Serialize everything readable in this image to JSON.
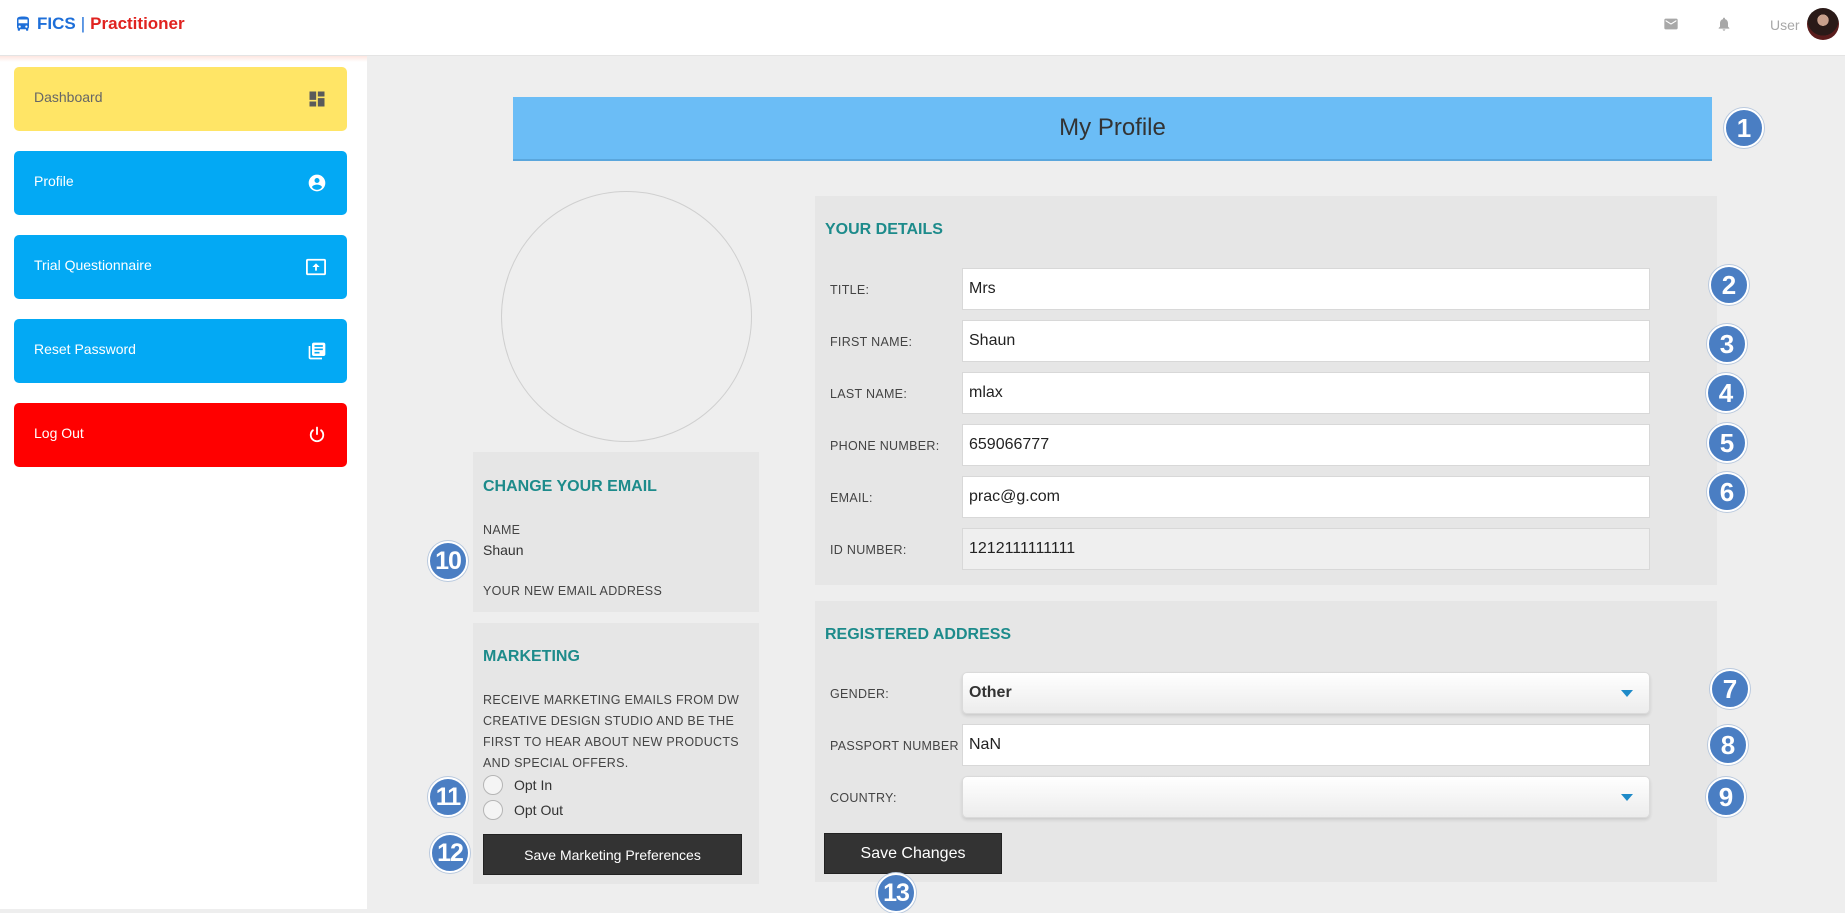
{
  "header": {
    "brand_primary": "FICS",
    "brand_separator": "|",
    "brand_secondary": "Practitioner",
    "user_label": "User",
    "icons": [
      "bus-icon",
      "mail-icon",
      "bell-icon"
    ]
  },
  "sidebar": {
    "items": [
      {
        "label": "Dashboard",
        "icon": "dashboard-icon"
      },
      {
        "label": "Profile",
        "icon": "account-circle-icon"
      },
      {
        "label": "Trial Questionnaire",
        "icon": "upload-screen-icon"
      },
      {
        "label": "Reset Password",
        "icon": "library-books-icon"
      },
      {
        "label": "Log Out",
        "icon": "power-icon"
      }
    ]
  },
  "page": {
    "title": "My Profile"
  },
  "details": {
    "heading": "YOUR DETAILS",
    "title_label": "TITLE:",
    "title_value": "Mrs",
    "first_name_label": "FIRST NAME:",
    "first_name_value": "Shaun",
    "last_name_label": "LAST NAME:",
    "last_name_value": "mlax",
    "phone_label": "PHONE NUMBER:",
    "phone_value": "659066777",
    "email_label": "EMAIL:",
    "email_value": "prac@g.com",
    "id_label": "ID NUMBER:",
    "id_value": "1212111111111"
  },
  "address": {
    "heading": "REGISTERED ADDRESS",
    "gender_label": "GENDER:",
    "gender_value": "Other",
    "passport_label": "PASSPORT NUMBER",
    "passport_value": "NaN",
    "country_label": "COUNTRY:",
    "country_value": ""
  },
  "change_email": {
    "heading": "CHANGE YOUR EMAIL",
    "name_label": "NAME",
    "name_value": "Shaun",
    "new_email_label": "YOUR NEW EMAIL ADDRESS"
  },
  "marketing": {
    "heading": "MARKETING",
    "description": "RECEIVE MARKETING EMAILS FROM DW CREATIVE DESIGN STUDIO AND BE THE FIRST TO HEAR ABOUT NEW PRODUCTS AND SPECIAL OFFERS.",
    "opt_in_label": "Opt In",
    "opt_out_label": "Opt Out",
    "save_label": "Save Marketing Preferences"
  },
  "actions": {
    "save_changes_label": "Save Changes"
  },
  "badges": [
    "1",
    "2",
    "3",
    "4",
    "5",
    "6",
    "7",
    "8",
    "9",
    "10",
    "11",
    "12",
    "13"
  ],
  "colors": {
    "accent_blue": "#03a9f4",
    "title_bar_blue": "#6bbdf6",
    "dashboard_yellow": "#ffe566",
    "logout_red": "#ff0000",
    "heading_teal": "#1d8b8b",
    "badge_blue": "#4a7ec3",
    "brand_blue": "#1e6fd9",
    "brand_red": "#e0221f"
  }
}
